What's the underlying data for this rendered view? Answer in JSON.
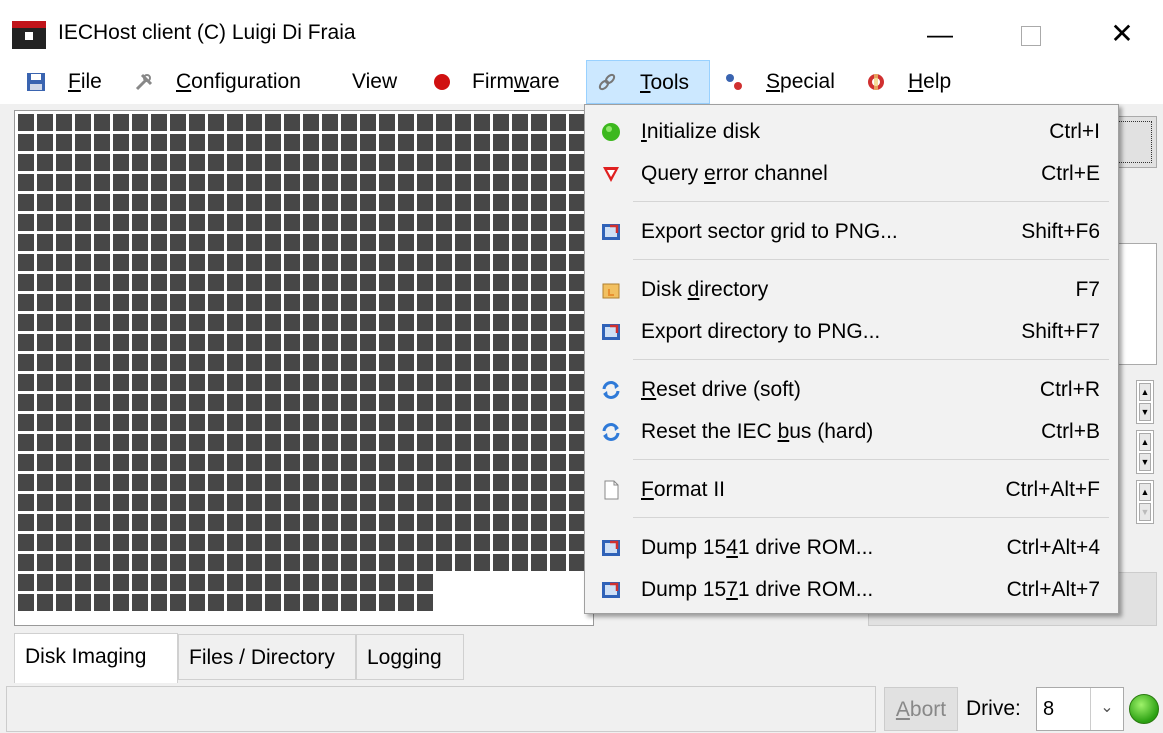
{
  "window": {
    "title": "IECHost client (C) Luigi Di Fraia",
    "minimize": "—",
    "close": "✕"
  },
  "menubar": {
    "file": {
      "pre": "",
      "ul": "F",
      "post": "ile"
    },
    "configuration": {
      "pre": "",
      "ul": "C",
      "post": "onfiguration"
    },
    "view": {
      "pre": "View",
      "ul": "",
      "post": ""
    },
    "firmware": {
      "pre": "Firm",
      "ul": "w",
      "post": "are"
    },
    "tools": {
      "pre": "",
      "ul": "T",
      "post": "ools"
    },
    "special": {
      "pre": "",
      "ul": "S",
      "post": "pecial"
    },
    "help": {
      "pre": "",
      "ul": "H",
      "post": "elp"
    }
  },
  "tools_menu": {
    "items": [
      {
        "pre": "",
        "ul": "I",
        "post": "nitialize disk",
        "shortcut": "Ctrl+I",
        "icon": "green-circle-icon"
      },
      {
        "pre": "Query ",
        "ul": "e",
        "post": "rror channel",
        "shortcut": "Ctrl+E",
        "icon": "red-triangle-icon"
      },
      {
        "pre": "Export sector grid to PNG...",
        "ul": "",
        "post": "",
        "shortcut": "Shift+F6",
        "icon": "export-image-icon"
      },
      {
        "pre": "Disk ",
        "ul": "d",
        "post": "irectory",
        "shortcut": "F7",
        "icon": "folder-hand-icon"
      },
      {
        "pre": "Export directory to PNG...",
        "ul": "",
        "post": "",
        "shortcut": "Shift+F7",
        "icon": "export-image-icon"
      },
      {
        "pre": "",
        "ul": "R",
        "post": "eset drive (soft)",
        "shortcut": "Ctrl+R",
        "icon": "refresh-icon"
      },
      {
        "pre": "Reset the IEC ",
        "ul": "b",
        "post": "us (hard)",
        "shortcut": "Ctrl+B",
        "icon": "refresh-icon"
      },
      {
        "pre": "",
        "ul": "F",
        "post": "ormat II",
        "shortcut": "Ctrl+Alt+F",
        "icon": "blank-page-icon"
      },
      {
        "pre": "Dump 15",
        "ul": "4",
        "post": "1 drive ROM...",
        "shortcut": "Ctrl+Alt+4",
        "icon": "export-image-icon"
      },
      {
        "pre": "Dump 15",
        "ul": "7",
        "post": "1 drive ROM...",
        "shortcut": "Ctrl+Alt+7",
        "icon": "export-image-icon"
      }
    ]
  },
  "tabs": [
    "Disk Imaging",
    "Files / Directory",
    "Logging"
  ],
  "statusbar": {
    "abort": {
      "pre": "",
      "ul": "A",
      "post": "bort"
    },
    "drive_label": "Drive:",
    "drive_value": "8",
    "led_color": "#2ba012"
  },
  "colors": {
    "sector": "#474747",
    "menu_active": "#cce8ff"
  }
}
